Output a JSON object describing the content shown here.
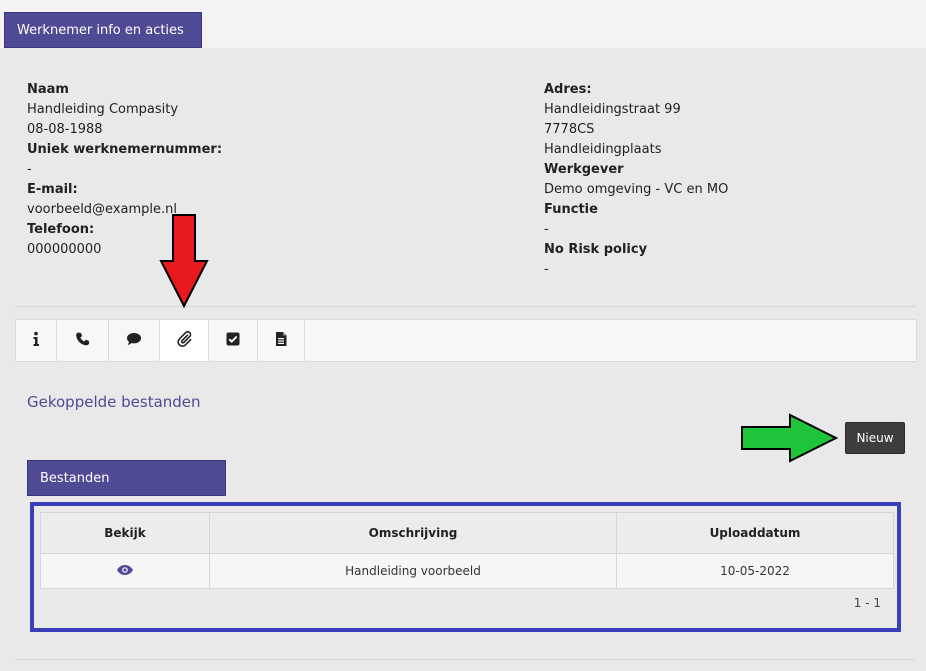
{
  "header": {
    "tab_label": "Werknemer info en acties"
  },
  "employee": {
    "left": [
      {
        "label": "Naam",
        "values": [
          "Handleiding Compasity",
          "08-08-1988"
        ]
      },
      {
        "label": "Uniek werknemernummer:",
        "values": [
          "-"
        ]
      },
      {
        "label": "E-mail:",
        "values": [
          "voorbeeld@example.nl"
        ]
      },
      {
        "label": "Telefoon:",
        "values": [
          "000000000"
        ]
      }
    ],
    "right": [
      {
        "label": "Adres:",
        "values": [
          "Handleidingstraat 99",
          "7778CS",
          "Handleidingplaats"
        ]
      },
      {
        "label": "Werkgever",
        "values": [
          "Demo omgeving - VC en MO"
        ]
      },
      {
        "label": "Functie",
        "values": [
          "-"
        ]
      },
      {
        "label": "No Risk policy",
        "values": [
          "-"
        ]
      }
    ]
  },
  "iconbar": {
    "items": [
      {
        "icon": "info-icon"
      },
      {
        "icon": "phone-icon"
      },
      {
        "icon": "comment-icon"
      },
      {
        "icon": "paperclip-icon",
        "active": true
      },
      {
        "icon": "checkbox-icon"
      },
      {
        "icon": "document-icon"
      }
    ]
  },
  "files_section": {
    "title": "Gekoppelde bestanden",
    "new_button": "Nieuw",
    "tab_label": "Bestanden",
    "columns": [
      "Bekijk",
      "Omschrijving",
      "Uploaddatum"
    ],
    "rows": [
      {
        "view_icon": "eye-icon",
        "description": "Handleiding voorbeeld",
        "upload_date": "10-05-2022"
      }
    ],
    "pagination": "1 - 1"
  },
  "colors": {
    "accent": "#4e4a94",
    "annotation_red": "#e8191f",
    "annotation_green": "#1ec43a",
    "highlight_frame": "#3a3fb9"
  }
}
